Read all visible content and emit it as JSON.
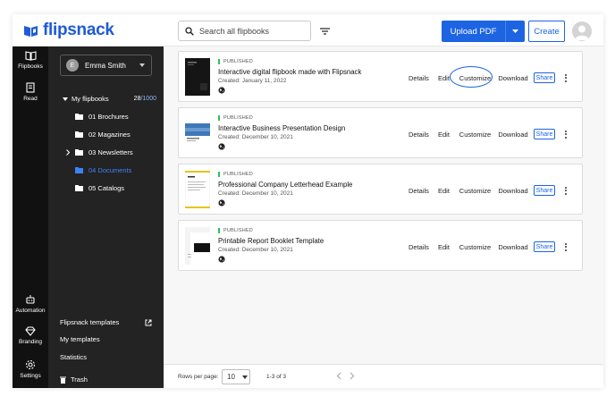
{
  "app": {
    "logo_text": "flipsnack"
  },
  "topbar": {
    "search_placeholder": "Search all flipbooks",
    "upload_label": "Upload PDF",
    "create_label": "Create"
  },
  "rail": [
    {
      "label": "Flipbooks",
      "icon": "flipbook-icon"
    },
    {
      "label": "Read",
      "icon": "read-icon"
    },
    {
      "label": "Automation",
      "icon": "automation-icon"
    },
    {
      "label": "Branding",
      "icon": "branding-icon"
    },
    {
      "label": "Settings",
      "icon": "gear-icon"
    }
  ],
  "sidebar": {
    "user_initial": "E",
    "user_name": "Emma Smith",
    "my_flipbooks": "My flipbooks",
    "count_used": "28",
    "count_total": "/1000",
    "folders": [
      {
        "label": "01 Brochures"
      },
      {
        "label": "02 Magazines"
      },
      {
        "label": "03 Newsletters"
      },
      {
        "label": "04 Documents"
      },
      {
        "label": "05 Catalogs"
      }
    ],
    "templates": "Flipsnack templates",
    "my_templates": "My templates",
    "statistics": "Statistics",
    "trash": "Trash"
  },
  "actions": {
    "details": "Details",
    "edit": "Edit",
    "customize": "Customize",
    "download": "Download",
    "share": "Share"
  },
  "flipbooks": [
    {
      "status": "PUBLISHED",
      "title": "Interactive digital flipbook made with Flipsnack",
      "created": "Created: January 11, 2022"
    },
    {
      "status": "PUBLISHED",
      "title": "Interactive Business Presentation Design",
      "created": "Created: December 10, 2021"
    },
    {
      "status": "PUBLISHED",
      "title": "Professional Company Letterhead Example",
      "created": "Created: December 10, 2021"
    },
    {
      "status": "PUBLISHED",
      "title": "Printable Report Booklet Template",
      "created": "Created: December 10, 2021"
    }
  ],
  "footer": {
    "rows_label": "Rows per page:",
    "rows_value": "10",
    "range": "1-3 of 3"
  },
  "colors": {
    "accent": "#1d64e3",
    "published": "#2fbf5a",
    "active_folder": "#3d82f5"
  }
}
